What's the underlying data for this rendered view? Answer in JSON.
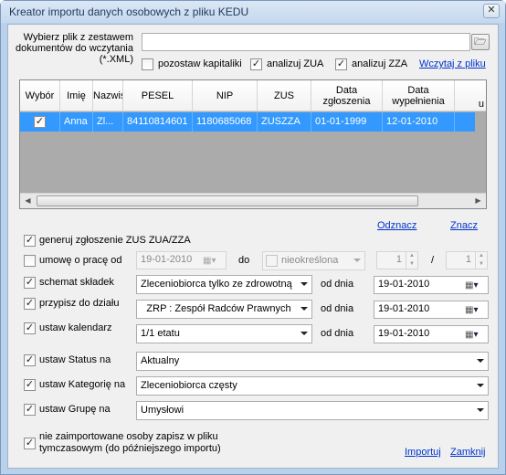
{
  "window": {
    "title": "Kreator importu danych osobowych z pliku KEDU",
    "close": "✕"
  },
  "file": {
    "label": "Wybierz plik z zestawem dokumentów do wczytania (*.XML)",
    "value": "",
    "browse_icon": "folder-icon",
    "opt_keep_caps": "pozostaw kapitaliki",
    "opt_keep_caps_checked": false,
    "opt_zua": "analizuj ZUA",
    "opt_zua_checked": true,
    "opt_zza": "analizuj ZZA",
    "opt_zza_checked": true,
    "load_link": "Wczytaj z pliku"
  },
  "grid": {
    "columns": [
      "Wybór",
      "Imię",
      "Nazwisko",
      "PESEL",
      "NIP",
      "ZUS",
      "Data zgłoszenia",
      "Data wypełnienia",
      "u"
    ],
    "rows": [
      {
        "selected": true,
        "imie": "Anna",
        "nazwisko": "Zl...",
        "pesel": "84110814601",
        "nip": "1180685068",
        "zus": "ZUSZZA",
        "data_zgloszenia": "01-01-1999",
        "data_wypelnienia": "12-01-2010"
      }
    ]
  },
  "links": {
    "unselect": "Odznacz",
    "select": "Znacz"
  },
  "options": {
    "generate": {
      "label": "generuj zgłoszenie ZUS ZUA/ZZA",
      "checked": true
    },
    "contract": {
      "label": "umowę o pracę od",
      "checked": false,
      "from_date": "19-01-2010",
      "to_label": "do",
      "indefinite_label": "nieokreślona",
      "indefinite_checked": false,
      "ratio_num": "1",
      "ratio_sep": "/",
      "ratio_den": "1"
    },
    "schema": {
      "label": "schemat składek",
      "checked": true,
      "value": "Zleceniobiorca tylko ze zdrowotną",
      "date_label": "od dnia",
      "date": "19-01-2010"
    },
    "department": {
      "label": "przypisz do działu",
      "checked": true,
      "value": "ZRP : Zespół Radców Prawnych",
      "date_label": "od dnia",
      "date": "19-01-2010"
    },
    "calendar": {
      "label": "ustaw kalendarz",
      "checked": true,
      "value": "1/1 etatu",
      "date_label": "od dnia",
      "date": "19-01-2010"
    },
    "status": {
      "label": "ustaw Status na",
      "checked": true,
      "value": "Aktualny"
    },
    "category": {
      "label": "ustaw Kategorię na",
      "checked": true,
      "value": "Zleceniobiorca częsty"
    },
    "group": {
      "label": "ustaw Grupę na",
      "checked": true,
      "value": "Umysłowi"
    },
    "temp": {
      "label": "nie zaimportowane osoby zapisz w pliku tymczasowym (do późniejszego importu)",
      "checked": true
    }
  },
  "footer": {
    "import": "Importuj",
    "close": "Zamknij"
  },
  "icons": {
    "check": "✓",
    "calendar": "calendar-icon",
    "spin": "spinner-icon"
  }
}
